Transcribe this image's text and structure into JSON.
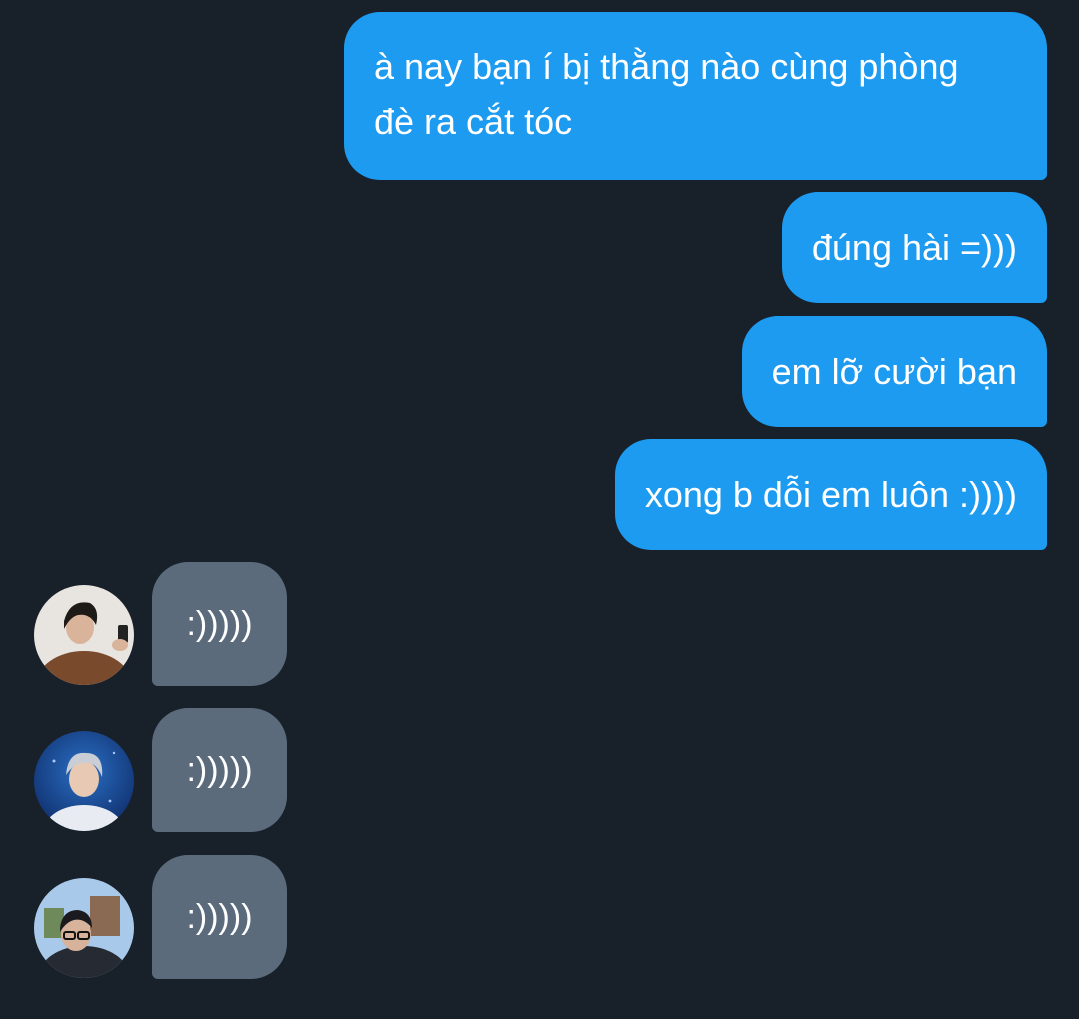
{
  "conversation": {
    "outgoing": [
      {
        "text": "à nay bạn í bị thằng nào cùng phòng\nđè ra cắt tóc"
      },
      {
        "text": "đúng hài =)))"
      },
      {
        "text": "em lỡ cười bạn"
      },
      {
        "text": "xong b dỗi em luôn :))))"
      }
    ],
    "incoming": [
      {
        "text": ":)))))",
        "avatar_icon": "user-photo-avatar-1"
      },
      {
        "text": ":)))))",
        "avatar_icon": "user-photo-avatar-2"
      },
      {
        "text": ":)))))",
        "avatar_icon": "user-photo-avatar-3"
      }
    ]
  },
  "colors": {
    "background": "#18202a",
    "outgoing_bubble": "#1d9bf0",
    "incoming_bubble": "#5b6b7c",
    "text": "#ffffff"
  }
}
